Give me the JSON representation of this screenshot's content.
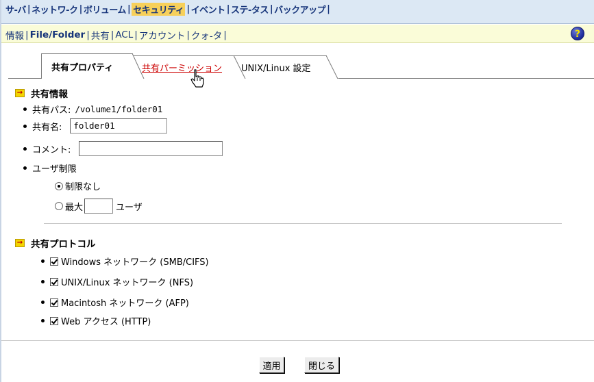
{
  "menu": {
    "items": [
      "サ-バ",
      "ネットワ-ク",
      "ボリューム",
      "セキュリティ",
      "イベント",
      "ステ-タス",
      "バックアップ"
    ],
    "active_index": 3,
    "separator": "|"
  },
  "submenu": {
    "items": [
      "情報",
      "File/Folder",
      "共有",
      "ACL",
      "アカウント",
      "クォ-タ"
    ],
    "active_index": 1,
    "separator": "|",
    "help_symbol": "?"
  },
  "tabs": {
    "share_property": "共有プロパティ",
    "share_permission": "共有パーミッション",
    "unix_linux": "UNIX/Linux 設定"
  },
  "share_info": {
    "heading": "共有情報",
    "path_label": "共有パス:",
    "path_value": "/volume1/folder01",
    "name_label": "共有名:",
    "name_value": "folder01",
    "comment_label": "コメント:",
    "comment_value": "",
    "user_limit_label": "ユーザ制限",
    "no_limit_label": "制限なし",
    "max_label": "最大",
    "max_value": "",
    "users_label": "ユーザ",
    "no_limit_selected": true
  },
  "protocols": {
    "heading": "共有プロトコル",
    "items": [
      {
        "label": "Windows ネットワーク (SMB/CIFS)",
        "checked": true
      },
      {
        "label": "UNIX/Linux ネットワーク (NFS)",
        "checked": true
      },
      {
        "label": "Macintosh ネットワーク (AFP)",
        "checked": true
      },
      {
        "label": "Web アクセス (HTTP)",
        "checked": true
      }
    ]
  },
  "buttons": {
    "apply": "適用",
    "close": "閉じる"
  },
  "colors": {
    "menu_bg": "#dce8f4",
    "menu_active": "#f7d05a",
    "submenu_bg": "#fafcd8",
    "link_text": "#16347a",
    "permission_tab_text": "#cc0000"
  }
}
